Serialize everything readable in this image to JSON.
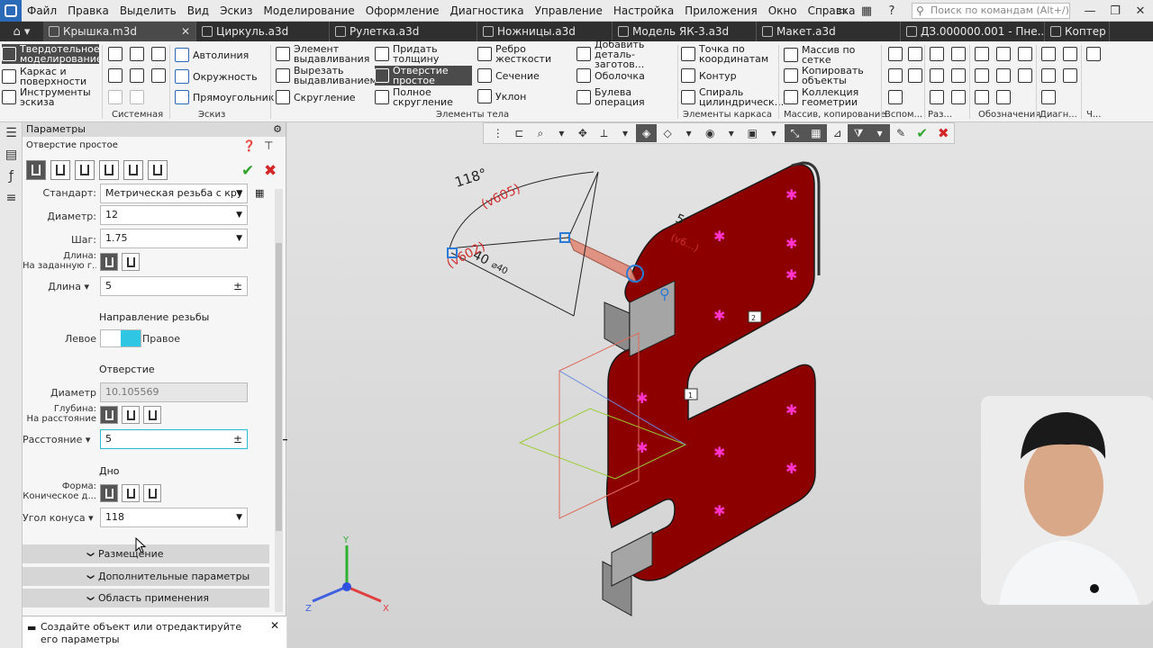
{
  "menubar": {
    "items": [
      "Файл",
      "Правка",
      "Выделить",
      "Вид",
      "Эскиз",
      "Моделирование",
      "Оформление",
      "Диагностика",
      "Управление",
      "Настройка",
      "Приложения",
      "Окно",
      "Справка"
    ],
    "search_placeholder": "Поиск по командам (Alt+/)"
  },
  "tabs": [
    {
      "label": "Крышка.m3d",
      "active": true
    },
    {
      "label": "Циркуль.a3d"
    },
    {
      "label": "Рулетка.a3d"
    },
    {
      "label": "Ножницы.a3d"
    },
    {
      "label": "Модель ЯК-3.a3d"
    },
    {
      "label": "Макет.a3d"
    },
    {
      "label": "ДЗ.000000.001 - Пне..."
    },
    {
      "label": "Коптер"
    }
  ],
  "ribbon": {
    "modes": [
      "Твердотельное моделирование",
      "Каркас и поверхности",
      "Инструменты эскиза"
    ],
    "sketch": [
      "Автолиния",
      "Окружность",
      "Прямоугольник"
    ],
    "body1": [
      "Элемент выдавливания",
      "Вырезать выдавливанием",
      "Скругление"
    ],
    "body2": [
      "Придать толщину",
      "Отверстие простое",
      "Полное скругление"
    ],
    "body3": [
      "Ребро жесткости",
      "Сечение",
      "Уклон"
    ],
    "body4": [
      "Добавить деталь-заготов...",
      "Оболочка",
      "Булева операция"
    ],
    "frame": [
      "Точка по координатам",
      "Контур",
      "Спираль цилиндрическ..."
    ],
    "array": [
      "Массив по сетке",
      "Копировать объекты",
      "Коллекция геометрии"
    ],
    "groups": [
      "Системная",
      "Эскиз",
      "Элементы тела",
      "Элементы каркаса",
      "Массив, копирование",
      "Вспом...",
      "Раз...",
      "Обозначения",
      "Диагн...",
      "Ч..."
    ]
  },
  "params": {
    "header": "Параметры",
    "operation": "Отверстие простое",
    "standard_label": "Стандарт:",
    "standard_value": "Метрическая резьба с кру",
    "diameter_label": "Диаметр:",
    "diameter_value": "12",
    "pitch_label": "Шаг:",
    "pitch_value": "1.75",
    "length_mode_label": "Длина:",
    "length_mode_value": "На заданную г...",
    "length_label": "Длина",
    "length_value": "5",
    "thread_dir_title": "Направление резьбы",
    "thread_left": "Левое",
    "thread_right": "Правое",
    "hole_title": "Отверстие",
    "hole_diameter_label": "Диаметр",
    "hole_diameter_value": "10.105569",
    "depth_mode_label": "Глубина:",
    "depth_mode_value": "На расстояние",
    "distance_label": "Расстояние",
    "distance_value": "5",
    "bottom_title": "Дно",
    "shape_label": "Форма:",
    "shape_value": "Коническое д...",
    "cone_angle_label": "Угол конуса",
    "cone_angle_value": "118",
    "sections": [
      "Размещение",
      "Дополнительные параметры",
      "Область применения"
    ],
    "status": "Создайте объект или отредактируйте его параметры"
  },
  "viewport": {
    "dim_angle": "118°",
    "dim_angle_ref": "(v605)",
    "dim_len": "40",
    "dim_len_ref": "(v602)",
    "dim_small": "5",
    "dim_small_ref": "(v6...)",
    "dim_040": "⌀40",
    "marker_1": "1",
    "marker_2": "2",
    "axis_x": "X",
    "axis_y": "Y",
    "axis_z": "Z",
    "model_color": "#8d0000",
    "accent": "#2fc6e3"
  }
}
